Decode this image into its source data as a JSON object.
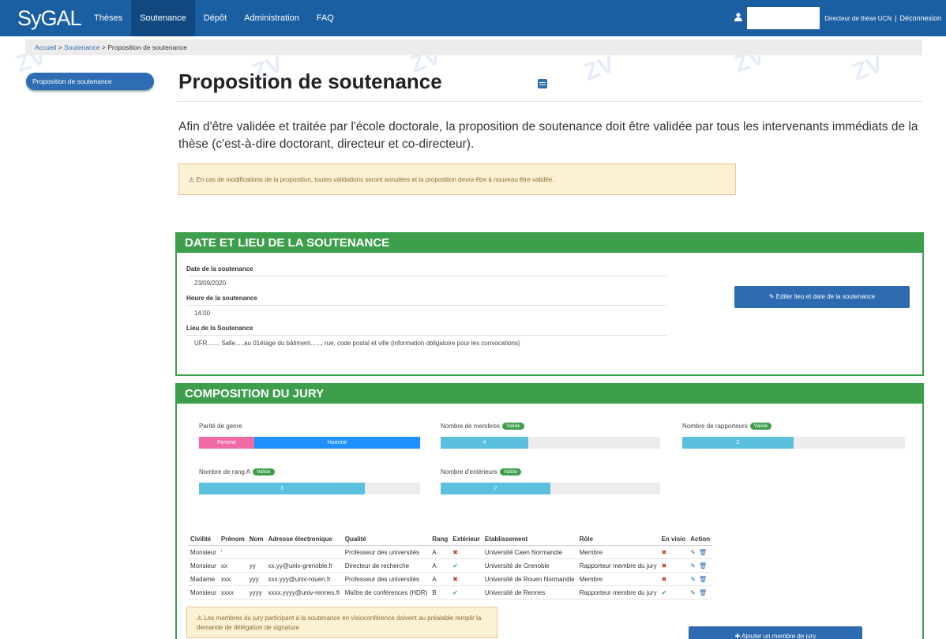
{
  "navbar": {
    "brand": "SyGAL",
    "items": [
      "Thèses",
      "Soutenance",
      "Dépôt",
      "Administration",
      "FAQ"
    ],
    "active_index": 1,
    "role": "Directeur de thèse UCN",
    "separator": "|",
    "logout": "Déconnexion"
  },
  "breadcrumb": {
    "home": "Accueil",
    "section": "Soutenance",
    "current": "Proposition de soutenance",
    "sep": ">"
  },
  "sidebar": {
    "active_item": "Proposition de soutenance"
  },
  "page": {
    "title": "Proposition de soutenance",
    "intro": "Afin d'être validée et traitée par l'école doctorale, la proposition de soutenance doit être validée par tous les intervenants immédiats de la thèse (c'est-à-dire doctorant, directeur et co-directeur).",
    "warning": "En cas de modifications de la proposition, toutes validations seront annulées et la proposition devra être à nouveau être validée."
  },
  "date_panel": {
    "title": "DATE ET LIEU DE LA SOUTENANCE",
    "date_label": "Date de la soutenance",
    "date_value": "23/09/2020",
    "hour_label": "Heure de la soutenance",
    "hour_value": "14:00",
    "place_label": "Lieu de la Soutenance",
    "place_value": "UFR......, Salle.....au 01étage du bâtiment......, rue, code postal et ville (information obligatoire pour les convocations)",
    "edit_button": "Editer lieu et date de la soutenance"
  },
  "jury_panel": {
    "title": "COMPOSITION DU JURY",
    "stats": {
      "parity": {
        "label": "Parité de genre",
        "femme_label": "Femme",
        "homme_label": "Homme",
        "femme_fraction": 0.25
      },
      "membres": {
        "label": "Nombre de membres",
        "badge": "Valide",
        "value": "4",
        "fraction": 0.4
      },
      "rapporteurs": {
        "label": "Nombre de rapporteurs",
        "badge": "Valide",
        "value": "2",
        "fraction": 0.5
      },
      "rang_a": {
        "label": "Nombre de rang A",
        "badge": "Valide",
        "value": "3",
        "fraction": 0.75
      },
      "exterieurs": {
        "label": "Nombre d'extérieurs",
        "badge": "Valide",
        "value": "2",
        "fraction": 0.5
      }
    },
    "table": {
      "headers": [
        "Civilité",
        "Prénom",
        "Nom",
        "Adresse électronique",
        "Qualité",
        "Rang",
        "Extérieur",
        "Etablissement",
        "Rôle",
        "En visio",
        "Action"
      ],
      "rows": [
        [
          "Monsieur",
          "'",
          "",
          "",
          "Professeur des universités",
          "A",
          "✖",
          "Université Caen Normandie",
          "Membre",
          "✖"
        ],
        [
          "Monsieur",
          "xx",
          "yy",
          "xx.yy@univ-grenoble.fr",
          "Directeur de recherche",
          "A",
          "✔",
          "Université de Grenoble",
          "Rapporteur membre du jury",
          "✖"
        ],
        [
          "Madame",
          "xxx",
          "yyy",
          "xxx.yyy@univ-rouen.fr",
          "Professeur des universités",
          "A",
          "✖",
          "Université de Rouen Normandie",
          "Membre",
          "✖"
        ],
        [
          "Monsieur",
          "xxxx",
          "yyyy",
          "xxxx.yyyy@univ-rennes.fr",
          "Maître de conférences (HDR)",
          "B",
          "✔",
          "Université de Rennes",
          "Rapporteur membre du jury",
          "✔"
        ]
      ]
    },
    "visio_warning": "Les membres du jury participant à la soutenance en visioconférence doivent au préalable remplir la demande de délégation de signature",
    "add_button": "Ajouter un membre de jury"
  },
  "colors": {
    "primary": "#1b5fa3",
    "panel_green": "#3d9f4c",
    "progress": "#5bc0de",
    "femme": "#f06aa6",
    "homme": "#1e90ff"
  }
}
